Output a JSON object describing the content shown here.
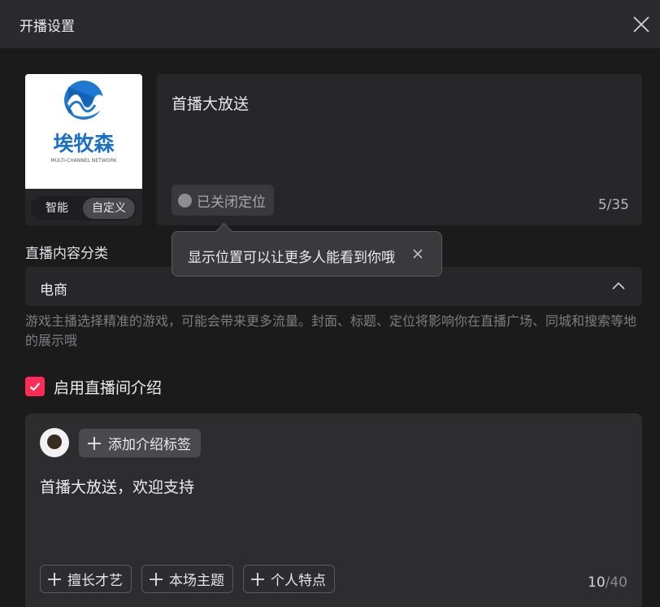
{
  "header": {
    "title": "开播设置"
  },
  "cover": {
    "logo_name": "埃牧森",
    "logo_subtitle": "MULTI-CHANNEL NETWORK",
    "modes": [
      {
        "label": "智能"
      },
      {
        "label": "自定义",
        "selected": true
      }
    ]
  },
  "live_title": {
    "value": "首播大放送",
    "location_label": "已关闭定位",
    "char_count": "5/35"
  },
  "tooltip": {
    "text": "显示位置可以让更多人能看到你哦"
  },
  "category": {
    "label": "直播内容分类",
    "value": "电商",
    "hint": "游戏主播选择精准的游戏，可能会带来更多流量。封面、标题、定位将影响你在直播广场、同城和搜索等地的展示哦"
  },
  "intro": {
    "enable_label": "启用直播间介绍",
    "enabled": true,
    "add_tag_label": "添加介绍标签",
    "text": "首播大放送，欢迎支持",
    "chips": [
      {
        "label": "擅长才艺"
      },
      {
        "label": "本场主题"
      },
      {
        "label": "个人特点"
      }
    ],
    "count_current": "10",
    "count_max": "/40"
  },
  "colors": {
    "accent": "#fe2c55",
    "background": "#1b1b1c",
    "panel": "#272729",
    "logo_blue": "#1a6fc4"
  }
}
